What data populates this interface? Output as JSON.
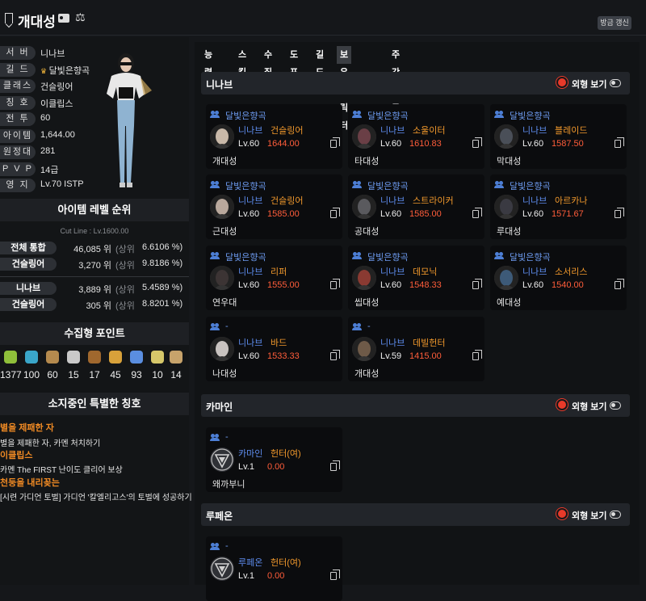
{
  "header": {
    "title": "개대성",
    "refresh_label": "방금 갱신"
  },
  "profile": [
    {
      "key": "서 버",
      "value": "니나브"
    },
    {
      "key": "길 드",
      "value": "달빛은향곡"
    },
    {
      "key": "클래스",
      "value": "건슬링어"
    },
    {
      "key": "칭 호",
      "value": "이클립스"
    },
    {
      "key": "전 투",
      "value": "60"
    },
    {
      "key": "아이템",
      "value": "1,644.00"
    },
    {
      "key": "원정대",
      "value": "281"
    },
    {
      "key": "P V P",
      "value": "14급"
    },
    {
      "key": "영 지",
      "value": "Lv.70 ISTP"
    }
  ],
  "ranking": {
    "title": "아이템 레벨 순위",
    "cutline": "Cut Line : Lv.1600.00",
    "rows": [
      {
        "label": "전체 통합",
        "rank": "46,085 위",
        "unit": "(상위",
        "pct": "6.6106 %)"
      },
      {
        "label": "건슬링어",
        "rank": "3,270 위",
        "unit": "(상위",
        "pct": "9.8186 %)"
      },
      {
        "label": "니나브",
        "rank": "3,889 위",
        "unit": "(상위",
        "pct": "5.4589 %)"
      },
      {
        "label": "건슬링어",
        "rank": "305 위",
        "unit": "(상위",
        "pct": "8.8201 %)"
      }
    ]
  },
  "collection": {
    "title": "수집형 포인트",
    "items": [
      {
        "icon": "mokoko-seed-icon",
        "value": "1377",
        "color": "#8fbf3a"
      },
      {
        "icon": "island-heart-icon",
        "value": "100",
        "color": "#3aa6c9"
      },
      {
        "icon": "art-icon",
        "value": "60",
        "color": "#b58a4e"
      },
      {
        "icon": "giant-heart-icon",
        "value": "15",
        "color": "#c9c9c9"
      },
      {
        "icon": "ignea-token-icon",
        "value": "17",
        "color": "#a0682e"
      },
      {
        "icon": "orpheus-star-icon",
        "value": "45",
        "color": "#d8a13a"
      },
      {
        "icon": "world-tree-leaf-icon",
        "value": "93",
        "color": "#5a8ee0"
      },
      {
        "icon": "sea-bounty-icon",
        "value": "10",
        "color": "#d6c76a"
      },
      {
        "icon": "mokoko-medal-icon",
        "value": "14",
        "color": "#c7a36b"
      }
    ]
  },
  "titles": {
    "title": "소지중인 특별한 칭호",
    "items": [
      {
        "name": "별을 제패한 자",
        "desc": "별을 제패한 자, 카멘 처치하기"
      },
      {
        "name": "이클립스",
        "desc": "카멘 The FIRST 난이도 클리어 보상"
      },
      {
        "name": "천둥을 내리꽂는",
        "desc": "[시련 가디언 토벌] 가디언 '칼엘리고스'의 토벌에 성공하기"
      }
    ]
  },
  "tabs": [
    "능력치",
    "스킬",
    "수집",
    "도표",
    "길드",
    "보유 캐릭터",
    "주간골드획득"
  ],
  "view_label": "외형 보기",
  "groups": [
    {
      "name": "니나브",
      "cards": [
        {
          "guild": "달빛은향곡",
          "server": "니나브",
          "cls": "건슬링어",
          "lv": "Lv.60",
          "ilvl": "1644.00",
          "name": "개대성",
          "avatar": "#c8b8a8"
        },
        {
          "guild": "달빛은향곡",
          "server": "니나브",
          "cls": "소울이터",
          "lv": "Lv.60",
          "ilvl": "1610.83",
          "name": "타대성",
          "avatar": "#6a3f46"
        },
        {
          "guild": "달빛은향곡",
          "server": "니나브",
          "cls": "블레이드",
          "lv": "Lv.60",
          "ilvl": "1587.50",
          "name": "막대성",
          "avatar": "#4a4f58"
        },
        {
          "guild": "달빛은향곡",
          "server": "니나브",
          "cls": "건슬링어",
          "lv": "Lv.60",
          "ilvl": "1585.00",
          "name": "근대성",
          "avatar": "#b9a89c"
        },
        {
          "guild": "달빛은향곡",
          "server": "니나브",
          "cls": "스트라이커",
          "lv": "Lv.60",
          "ilvl": "1585.00",
          "name": "공대성",
          "avatar": "#5a5a5e"
        },
        {
          "guild": "달빛은향곡",
          "server": "니나브",
          "cls": "아르카나",
          "lv": "Lv.60",
          "ilvl": "1571.67",
          "name": "루대성",
          "avatar": "#3a3a42"
        },
        {
          "guild": "달빛은향곡",
          "server": "니나브",
          "cls": "리퍼",
          "lv": "Lv.60",
          "ilvl": "1555.00",
          "name": "연우대",
          "avatar": "#3c3434"
        },
        {
          "guild": "달빛은향곡",
          "server": "니나브",
          "cls": "데모닉",
          "lv": "Lv.60",
          "ilvl": "1548.33",
          "name": "씹대성",
          "avatar": "#8a3a32"
        },
        {
          "guild": "달빛은향곡",
          "server": "니나브",
          "cls": "소서리스",
          "lv": "Lv.60",
          "ilvl": "1540.00",
          "name": "예대성",
          "avatar": "#3d5a78"
        },
        {
          "guild": "-",
          "server": "니나브",
          "cls": "바드",
          "lv": "Lv.60",
          "ilvl": "1533.33",
          "name": "나대성",
          "avatar": "#c9c3c0"
        },
        {
          "guild": "-",
          "server": "니나브",
          "cls": "데빌헌터",
          "lv": "Lv.59",
          "ilvl": "1415.00",
          "name": "개대성",
          "avatar": "#6e5a48"
        }
      ]
    },
    {
      "name": "카마인",
      "cards": [
        {
          "guild": "-",
          "server": "카마인",
          "cls": "헌터(여)",
          "lv": "Lv.1",
          "ilvl": "0.00",
          "name": "왜까부니",
          "avatar": "emblem"
        }
      ]
    },
    {
      "name": "루페온",
      "cards": [
        {
          "guild": "-",
          "server": "루페온",
          "cls": "헌터(여)",
          "lv": "Lv.1",
          "ilvl": "0.00",
          "name": "",
          "avatar": "emblem"
        }
      ]
    }
  ]
}
